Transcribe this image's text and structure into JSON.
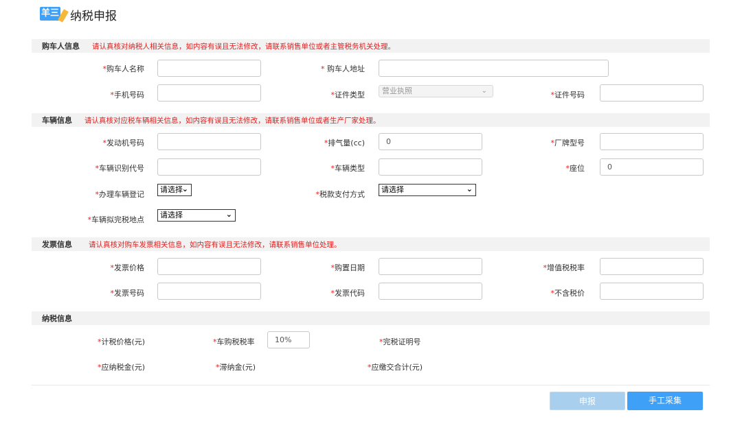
{
  "header": {
    "logo_text": "羊三",
    "title": "纳税申报"
  },
  "sections": {
    "buyer": {
      "title": "购车人信息",
      "note": "请认真核对纳税人相关信息，如内容有误且无法修改，请联系销售单位或者主管税务机关处理。"
    },
    "vehicle": {
      "title": "车辆信息",
      "note": "请认真核对应税车辆相关信息，如内容有误且无法修改，请联系销售单位或者生产厂家处理。"
    },
    "invoice": {
      "title": "发票信息",
      "note": "请认真核对购车发票相关信息，如内容有误且无法修改，请联系销售单位处理。"
    },
    "tax": {
      "title": "纳税信息"
    }
  },
  "fields": {
    "buyer_name": {
      "label": "购车人名称",
      "value": ""
    },
    "buyer_address": {
      "label": " 购车人地址",
      "value": ""
    },
    "phone": {
      "label": "手机号码",
      "value": ""
    },
    "id_type": {
      "label": "证件类型",
      "value": "营业执照"
    },
    "id_number": {
      "label": "证件号码",
      "value": ""
    },
    "engine_no": {
      "label": "发动机号码",
      "value": ""
    },
    "displacement": {
      "label": "排气量(cc)",
      "value": "0"
    },
    "model": {
      "label": "厂牌型号",
      "value": ""
    },
    "vin": {
      "label": "车辆识别代号",
      "value": ""
    },
    "vehicle_type": {
      "label": "车辆类型",
      "value": ""
    },
    "seats": {
      "label": "座位",
      "value": "0"
    },
    "registration": {
      "label": "办理车辆登记",
      "value": "请选择"
    },
    "payment_method": {
      "label": "税款支付方式",
      "value": "请选择"
    },
    "tax_location": {
      "label": "车辆拟完税地点",
      "value": "请选择"
    },
    "invoice_price": {
      "label": "发票价格",
      "value": ""
    },
    "purchase_date": {
      "label": "购置日期",
      "value": ""
    },
    "vat_rate": {
      "label": "增值税税率",
      "value": ""
    },
    "invoice_no": {
      "label": "发票号码",
      "value": ""
    },
    "invoice_code": {
      "label": "发票代码",
      "value": ""
    },
    "price_ex_tax": {
      "label": "不含税价",
      "value": ""
    },
    "taxable_price": {
      "label": "计税价格(元)"
    },
    "purchase_tax_rate": {
      "label": "车购税税率",
      "value": "10%"
    },
    "tax_cert_no": {
      "label": "完税证明号"
    },
    "tax_payable": {
      "label": "应纳税金(元)"
    },
    "late_fee": {
      "label": "滞纳金(元)"
    },
    "total_payable": {
      "label": "应缴交合计(元)"
    }
  },
  "buttons": {
    "submit": "申报",
    "manual_collect": "手工采集"
  },
  "required_mark": "*"
}
